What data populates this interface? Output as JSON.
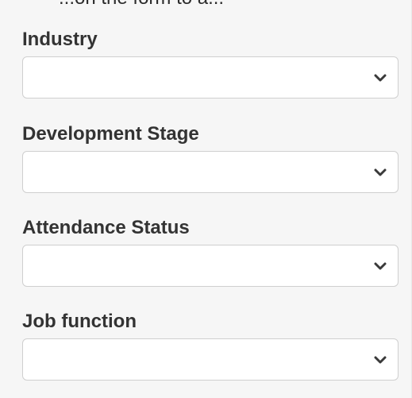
{
  "top_clip": {
    "text": "...on the form to a..."
  },
  "fields": [
    {
      "label": "Industry",
      "value": ""
    },
    {
      "label": "Development Stage",
      "value": ""
    },
    {
      "label": "Attendance Status",
      "value": ""
    },
    {
      "label": "Job function",
      "value": ""
    }
  ],
  "colors": {
    "background": "#f6f6f6",
    "select_background": "#ffffff",
    "select_border": "#cfcfcf",
    "label_text": "#333333",
    "chevron": "#3a3a3a"
  },
  "icons": {
    "dropdown": "chevron-down-icon"
  }
}
